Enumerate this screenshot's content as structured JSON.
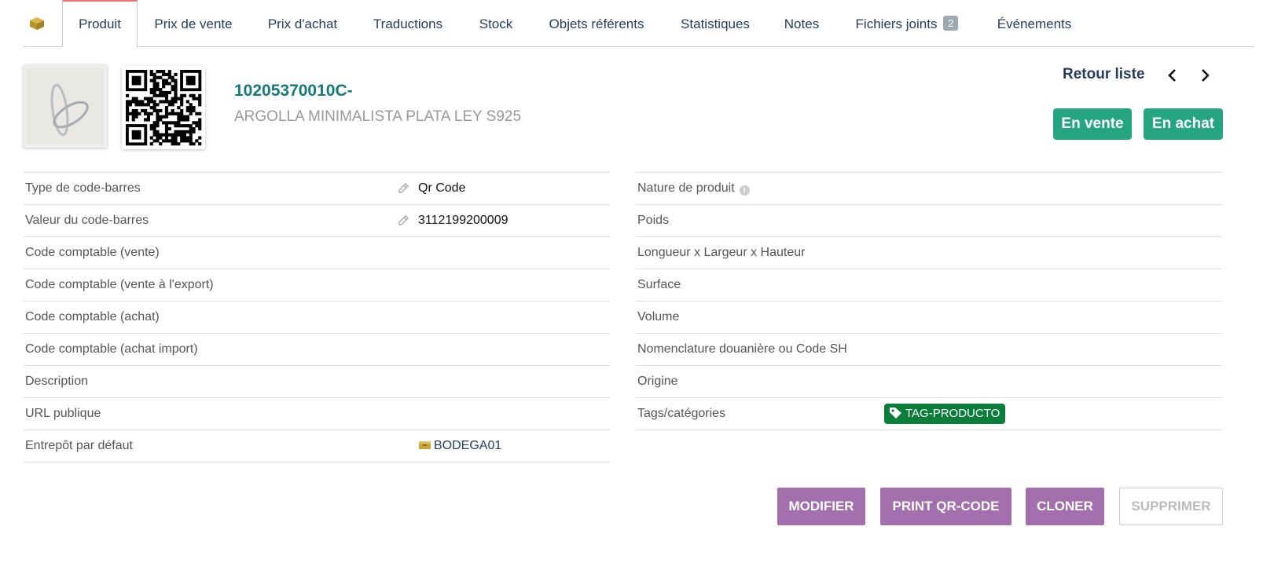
{
  "tabs": [
    {
      "label": "Produit",
      "active": true
    },
    {
      "label": "Prix de vente"
    },
    {
      "label": "Prix d'achat"
    },
    {
      "label": "Traductions"
    },
    {
      "label": "Stock"
    },
    {
      "label": "Objets référents"
    },
    {
      "label": "Statistiques"
    },
    {
      "label": "Notes"
    },
    {
      "label": "Fichiers joints",
      "badge": "2"
    },
    {
      "label": "Événements"
    }
  ],
  "header": {
    "ref": "10205370010C-",
    "label": "ARGOLLA MINIMALISTA PLATA LEY S925",
    "back_label": "Retour liste",
    "status_sell": "En vente",
    "status_buy": "En achat"
  },
  "left_fields": [
    {
      "label": "Type de code-barres",
      "value": "Qr Code"
    },
    {
      "label": "Valeur du code-barres",
      "value": "3112199200009"
    },
    {
      "label": "Code comptable (vente)"
    },
    {
      "label": "Code comptable (vente à l'export)"
    },
    {
      "label": "Code comptable (achat)"
    },
    {
      "label": "Code comptable (achat import)"
    },
    {
      "label": "Description"
    },
    {
      "label": "URL publique"
    },
    {
      "label": "Entrepôt par défaut",
      "value": "BODEGA01"
    }
  ],
  "right_fields": [
    {
      "label": "Nature de produit"
    },
    {
      "label": "Poids"
    },
    {
      "label": "Longueur x Largeur x Hauteur"
    },
    {
      "label": "Surface"
    },
    {
      "label": "Volume"
    },
    {
      "label": "Nomenclature douanière ou Code SH"
    },
    {
      "label": "Origine"
    },
    {
      "label": "Tags/catégories",
      "tag": "TAG-PRODUCTO"
    }
  ],
  "actions": {
    "modify": "MODIFIER",
    "print_qr": "PRINT QR-CODE",
    "clone": "CLONER",
    "delete": "SUPPRIMER"
  },
  "colors": {
    "status_green": "#25a580",
    "tag_green": "#0a7d3a",
    "action_purple": "#a36fad",
    "tab_active_border": "#ef6d6d",
    "ref_teal": "#16797a"
  }
}
